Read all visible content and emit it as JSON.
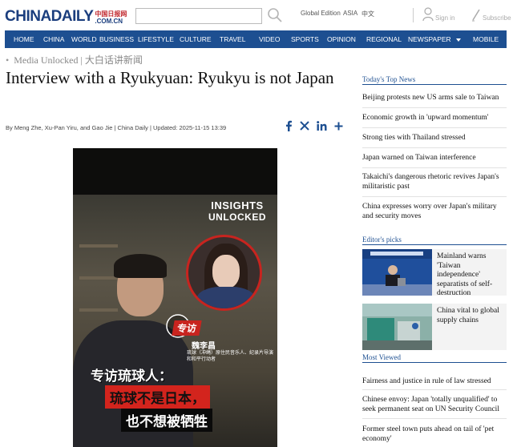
{
  "header": {
    "logo_main": "CHINADAILY",
    "logo_cn": "中国日报网",
    "logo_com": ".COM.CN",
    "search_placeholder": "",
    "global_edition": "Global Edition",
    "asia": "ASIA",
    "chinese": "中文",
    "sign_in": "Sign in",
    "subscribe": "Subscribe"
  },
  "nav": {
    "items": [
      "HOME",
      "CHINA",
      "WORLD",
      "BUSINESS",
      "LIFESTYLE",
      "CULTURE",
      "TRAVEL",
      "VIDEO",
      "SPORTS",
      "OPINION",
      "REGIONAL",
      "NEWSPAPER",
      "MOBILE"
    ]
  },
  "article": {
    "breadcrumb": "Media Unlocked | 大白话讲新闻",
    "title": "Interview with a Ryukyuan: Ryukyu is not Japan",
    "byline": "By Meng Zhe, Xu-Pan Yiru, and Gao Jie | China Daily | Updated: 2025-11-15 13:39"
  },
  "video": {
    "brand_line1": "INSIGHTS",
    "brand_line2": "UNLOCKED",
    "tag": "专访",
    "guest_name": "魏李昌",
    "guest_desc": "琉球（冲绳）原住民音乐人、纪录片导演和和平行动者",
    "caption1": "专访琉球人：",
    "caption2": "琉球不是日本，",
    "caption3": "也不想被牺牲"
  },
  "sidebar": {
    "top_news_heading": "Today's Top News",
    "top_news": [
      "Beijing protests new US arms sale to Taiwan",
      "Economic growth in 'upward momentum'",
      "Strong ties with Thailand stressed",
      "Japan warned on Taiwan interference",
      "Takaichi's dangerous rhetoric revives Japan's militaristic past",
      "China expresses worry over Japan's military and security moves"
    ],
    "editors_picks_heading": "Editor's picks",
    "editors_picks": [
      "Mainland warns 'Taiwan independence' separatists of self-destruction",
      "China vital to global supply chains"
    ],
    "most_viewed_heading": "Most Viewed",
    "most_viewed": [
      "Fairness and justice in rule of law stressed",
      "Chinese envoy: Japan 'totally unqualified' to seek permanent seat on UN Security Council",
      "Former steel town puts ahead on tail of 'pet economy'"
    ]
  },
  "colors": {
    "nav_bg": "#1d4f91",
    "logo_blue": "#1b3e7e",
    "accent_red": "#c8241f"
  }
}
